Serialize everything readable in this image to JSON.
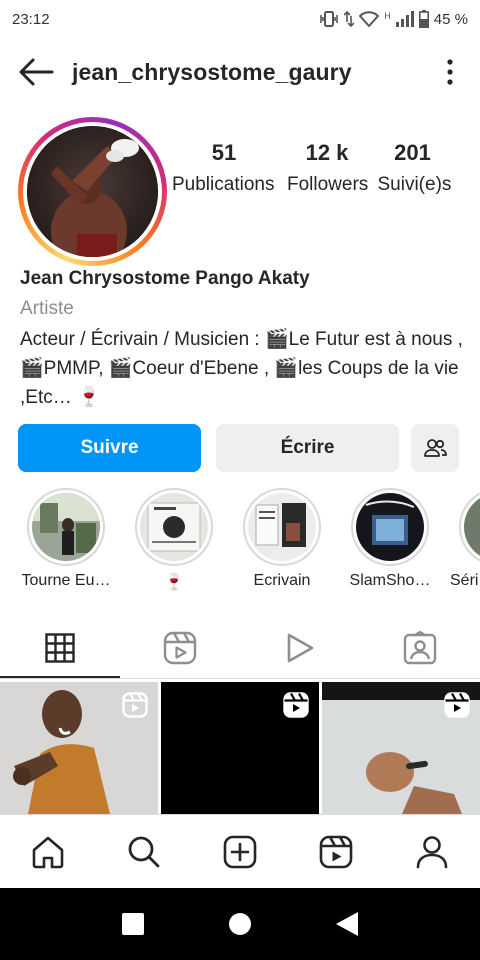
{
  "status_bar": {
    "time": "23:12",
    "battery": "45 %",
    "network": "H"
  },
  "header": {
    "username": "jean_chrysostome_gaury"
  },
  "profile": {
    "stats": [
      {
        "value": "51",
        "label": "Publications"
      },
      {
        "value": "12 k",
        "label": "Followers"
      },
      {
        "value": "201",
        "label": "Suivi(e)s"
      }
    ],
    "full_name": "Jean Chrysostome Pango Akaty",
    "category": "Artiste",
    "bio": "Acteur / Écrivain / Musicien : 🎬Le Futur est à nous ,🎬PMMP, 🎬Coeur d'Ebene , 🎬les Coups de la vie ,Etc… 🍷"
  },
  "actions": {
    "follow_label": "Suivre",
    "message_label": "Écrire"
  },
  "highlights": [
    {
      "label": "Tourne Eu…"
    },
    {
      "label": "🍷"
    },
    {
      "label": "Ecrivain"
    },
    {
      "label": "SlamSho…"
    },
    {
      "label": "Séri"
    }
  ],
  "colors": {
    "follow_button": "#0095f6",
    "secondary_button": "#efefef",
    "text": "#262626",
    "muted_text": "#8e8e8e"
  },
  "icons": {
    "back": "arrow-left-icon",
    "more": "more-vertical-icon",
    "suggest": "add-people-icon",
    "tabs": [
      "grid-icon",
      "reels-icon",
      "play-icon",
      "tagged-icon"
    ],
    "nav": [
      "home-icon",
      "search-icon",
      "create-icon",
      "reels-icon",
      "profile-icon"
    ]
  }
}
